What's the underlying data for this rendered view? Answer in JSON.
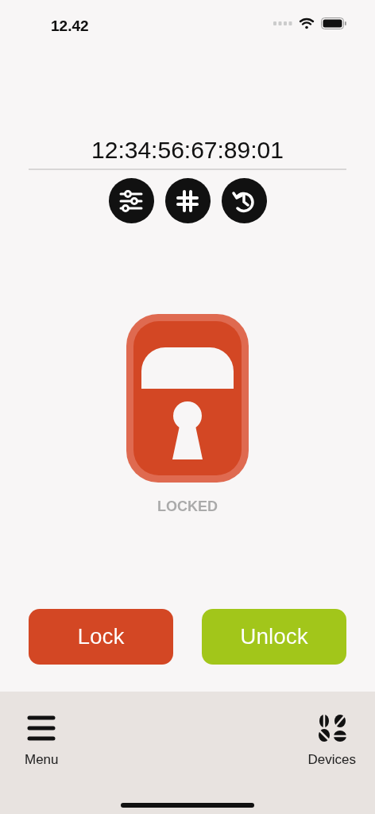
{
  "status_bar": {
    "time": "12.42"
  },
  "device": {
    "address": "12:34:56:67:89:01"
  },
  "tools": [
    {
      "kind": "settings"
    },
    {
      "kind": "hash"
    },
    {
      "kind": "history"
    }
  ],
  "lock": {
    "locked": true,
    "status": "LOCKED"
  },
  "actions": [
    {
      "label": "Lock",
      "color": "#d34724"
    },
    {
      "label": "Unlock",
      "color": "#a2c61a"
    }
  ],
  "tab_bar": [
    {
      "label": "Menu",
      "kind": "menu"
    },
    {
      "label": "Devices",
      "kind": "devices"
    }
  ]
}
